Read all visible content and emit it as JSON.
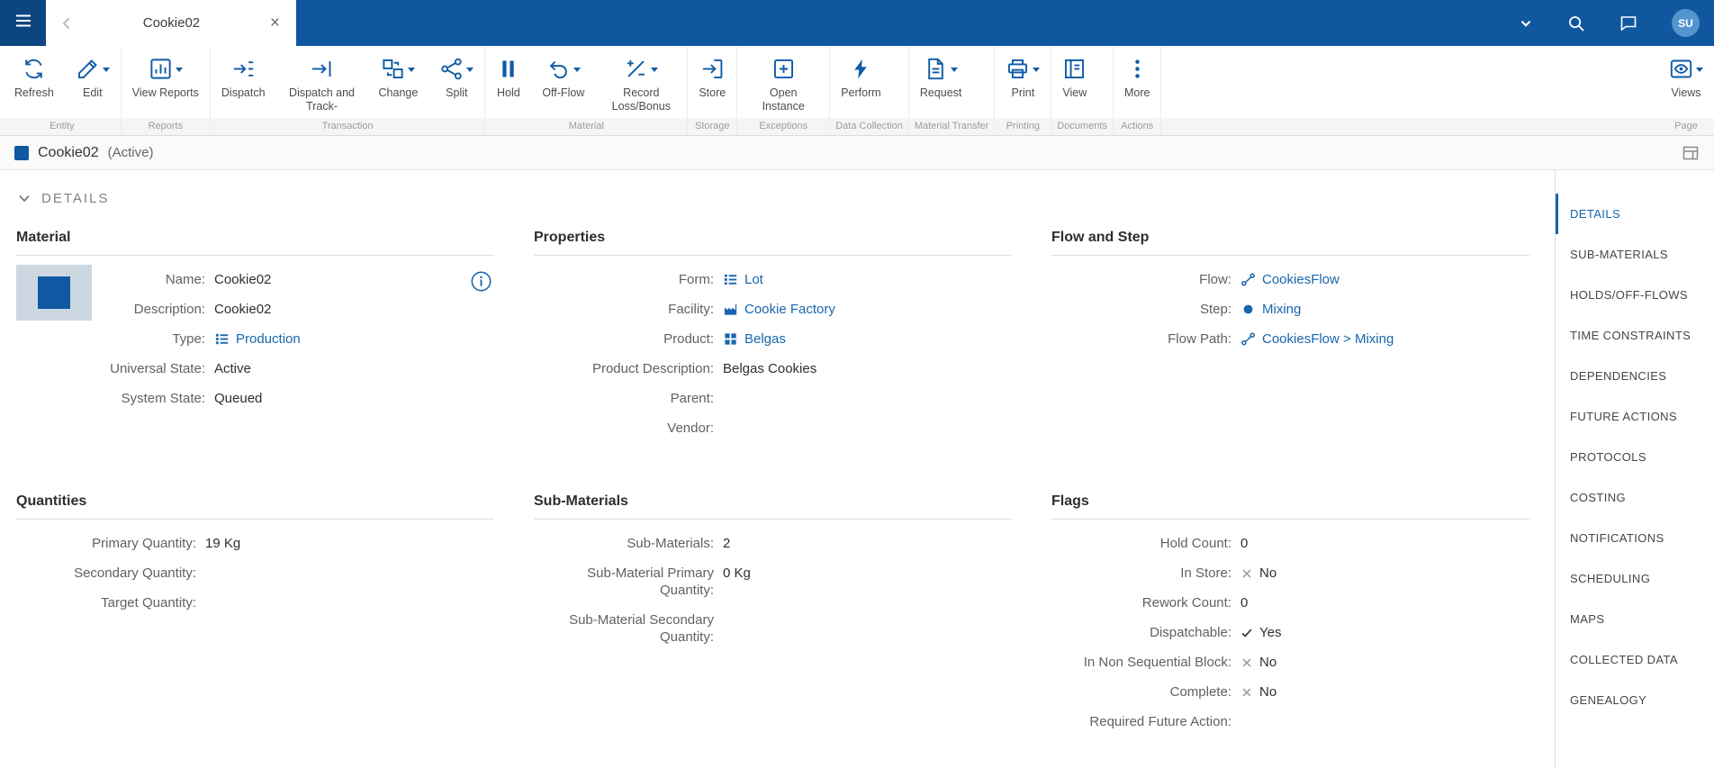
{
  "colors": {
    "topbar_blue": "#1057a0",
    "topbar_dark_blue": "#0c4681",
    "accent_blue": "#1158a2",
    "toolbar_icon_blue": "#0f5ba6",
    "link_blue": "#1866ad",
    "avatar_blue": "#5494cf"
  },
  "topbar": {
    "tab_title": "Cookie02",
    "tab_close": "×",
    "avatar_initials": "SU"
  },
  "toolbar": {
    "groups": [
      {
        "label": "Entity",
        "buttons": [
          {
            "label": "Refresh",
            "icon": "refresh-icon"
          },
          {
            "label": "Edit",
            "icon": "edit-icon",
            "menu": true
          }
        ]
      },
      {
        "label": "Reports",
        "buttons": [
          {
            "label": "View Reports",
            "icon": "bar-chart-icon",
            "menu": true
          }
        ]
      },
      {
        "label": "Transaction",
        "buttons": [
          {
            "label": "Dispatch",
            "icon": "dispatch-icon"
          },
          {
            "label": "Dispatch and Track-",
            "icon": "dispatch-track-icon"
          },
          {
            "label": "Change",
            "icon": "change-icon",
            "menu": true
          },
          {
            "label": "Split",
            "icon": "split-icon",
            "menu": true
          }
        ]
      },
      {
        "label": "Material",
        "buttons": [
          {
            "label": "Hold",
            "icon": "pause-icon"
          },
          {
            "label": "Off-Flow",
            "icon": "undo-icon",
            "menu": true
          },
          {
            "label": "Record Loss/Bonus",
            "icon": "plus-minus-icon",
            "menu": true
          }
        ]
      },
      {
        "label": "Storage",
        "buttons": [
          {
            "label": "Store",
            "icon": "store-icon"
          }
        ]
      },
      {
        "label": "Exceptions",
        "buttons": [
          {
            "label": "Open Instance",
            "icon": "open-instance-icon"
          }
        ]
      },
      {
        "label": "Data Collection",
        "buttons": [
          {
            "label": "Perform",
            "icon": "lightning-icon"
          }
        ]
      },
      {
        "label": "Material Transfer",
        "buttons": [
          {
            "label": "Request",
            "icon": "document-icon",
            "menu": true
          }
        ]
      },
      {
        "label": "Printing",
        "buttons": [
          {
            "label": "Print",
            "icon": "printer-icon",
            "menu": true
          }
        ]
      },
      {
        "label": "Documents",
        "buttons": [
          {
            "label": "View",
            "icon": "binder-icon"
          }
        ]
      },
      {
        "label": "Actions",
        "buttons": [
          {
            "label": "More",
            "icon": "ellipsis-icon"
          }
        ]
      },
      {
        "label": "Page",
        "buttons": [
          {
            "label": "Views",
            "icon": "eye-icon",
            "menu": true
          }
        ]
      }
    ]
  },
  "entity_header": {
    "title": "Cookie02",
    "state": "(Active)"
  },
  "details": {
    "section_title": "DETAILS",
    "material": {
      "title": "Material",
      "fields": [
        {
          "label": "Name:",
          "value": "Cookie02"
        },
        {
          "label": "Description:",
          "value": "Cookie02"
        },
        {
          "label": "Type:",
          "value": "Production",
          "link": true,
          "icon": "list-icon"
        },
        {
          "label": "Universal State:",
          "value": "Active"
        },
        {
          "label": "System State:",
          "value": "Queued"
        }
      ]
    },
    "properties": {
      "title": "Properties",
      "fields": [
        {
          "label": "Form:",
          "value": "Lot",
          "link": true,
          "icon": "list-icon"
        },
        {
          "label": "Facility:",
          "value": "Cookie Factory",
          "link": true,
          "icon": "factory-icon"
        },
        {
          "label": "Product:",
          "value": "Belgas",
          "link": true,
          "icon": "product-icon"
        },
        {
          "label": "Product Description:",
          "value": "Belgas Cookies"
        },
        {
          "label": "Parent:",
          "value": ""
        },
        {
          "label": "Vendor:",
          "value": ""
        }
      ]
    },
    "flow_and_step": {
      "title": "Flow and Step",
      "fields": [
        {
          "label": "Flow:",
          "value": "CookiesFlow",
          "link": true,
          "icon": "flow-icon"
        },
        {
          "label": "Step:",
          "value": "Mixing",
          "link": true,
          "icon": "step-icon"
        },
        {
          "label": "Flow Path:",
          "value": "CookiesFlow > Mixing",
          "link": true,
          "icon": "flow-icon"
        }
      ]
    },
    "quantities": {
      "title": "Quantities",
      "fields": [
        {
          "label": "Primary Quantity:",
          "value": "19 Kg"
        },
        {
          "label": "Secondary Quantity:",
          "value": ""
        },
        {
          "label": "Target Quantity:",
          "value": ""
        }
      ]
    },
    "sub_materials": {
      "title": "Sub-Materials",
      "fields": [
        {
          "label": "Sub-Materials:",
          "value": "2"
        },
        {
          "label": "Sub-Material Primary Quantity:",
          "value": "0 Kg"
        },
        {
          "label": "Sub-Material Secondary Quantity:",
          "value": ""
        }
      ]
    },
    "flags": {
      "title": "Flags",
      "fields": [
        {
          "label": "Hold Count:",
          "value": "0"
        },
        {
          "label": "In Store:",
          "value": "No",
          "status": "no"
        },
        {
          "label": "Rework Count:",
          "value": "0"
        },
        {
          "label": "Dispatchable:",
          "value": "Yes",
          "status": "yes"
        },
        {
          "label": "In Non Sequential Block:",
          "value": "No",
          "status": "no"
        },
        {
          "label": "Complete:",
          "value": "No",
          "status": "no"
        },
        {
          "label": "Required Future Action:",
          "value": ""
        }
      ]
    }
  },
  "sidebar": {
    "items": [
      {
        "label": "DETAILS",
        "active": true
      },
      {
        "label": "SUB-MATERIALS"
      },
      {
        "label": "HOLDS/OFF-FLOWS"
      },
      {
        "label": "TIME CONSTRAINTS"
      },
      {
        "label": "DEPENDENCIES"
      },
      {
        "label": "FUTURE ACTIONS"
      },
      {
        "label": "PROTOCOLS"
      },
      {
        "label": "COSTING"
      },
      {
        "label": "NOTIFICATIONS"
      },
      {
        "label": "SCHEDULING"
      },
      {
        "label": "MAPS"
      },
      {
        "label": "COLLECTED DATA"
      },
      {
        "label": "GENEALOGY"
      }
    ]
  }
}
